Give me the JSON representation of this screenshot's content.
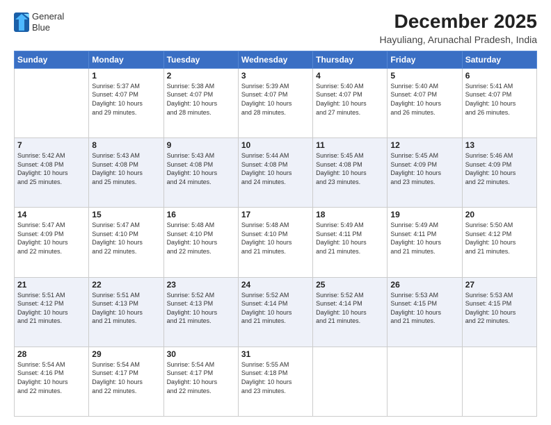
{
  "header": {
    "logo_line1": "General",
    "logo_line2": "Blue",
    "title": "December 2025",
    "subtitle": "Hayuliang, Arunachal Pradesh, India"
  },
  "days_of_week": [
    "Sunday",
    "Monday",
    "Tuesday",
    "Wednesday",
    "Thursday",
    "Friday",
    "Saturday"
  ],
  "weeks": [
    [
      {
        "day": "",
        "info": ""
      },
      {
        "day": "1",
        "info": "Sunrise: 5:37 AM\nSunset: 4:07 PM\nDaylight: 10 hours\nand 29 minutes."
      },
      {
        "day": "2",
        "info": "Sunrise: 5:38 AM\nSunset: 4:07 PM\nDaylight: 10 hours\nand 28 minutes."
      },
      {
        "day": "3",
        "info": "Sunrise: 5:39 AM\nSunset: 4:07 PM\nDaylight: 10 hours\nand 28 minutes."
      },
      {
        "day": "4",
        "info": "Sunrise: 5:40 AM\nSunset: 4:07 PM\nDaylight: 10 hours\nand 27 minutes."
      },
      {
        "day": "5",
        "info": "Sunrise: 5:40 AM\nSunset: 4:07 PM\nDaylight: 10 hours\nand 26 minutes."
      },
      {
        "day": "6",
        "info": "Sunrise: 5:41 AM\nSunset: 4:07 PM\nDaylight: 10 hours\nand 26 minutes."
      }
    ],
    [
      {
        "day": "7",
        "info": "Sunrise: 5:42 AM\nSunset: 4:08 PM\nDaylight: 10 hours\nand 25 minutes."
      },
      {
        "day": "8",
        "info": "Sunrise: 5:43 AM\nSunset: 4:08 PM\nDaylight: 10 hours\nand 25 minutes."
      },
      {
        "day": "9",
        "info": "Sunrise: 5:43 AM\nSunset: 4:08 PM\nDaylight: 10 hours\nand 24 minutes."
      },
      {
        "day": "10",
        "info": "Sunrise: 5:44 AM\nSunset: 4:08 PM\nDaylight: 10 hours\nand 24 minutes."
      },
      {
        "day": "11",
        "info": "Sunrise: 5:45 AM\nSunset: 4:08 PM\nDaylight: 10 hours\nand 23 minutes."
      },
      {
        "day": "12",
        "info": "Sunrise: 5:45 AM\nSunset: 4:09 PM\nDaylight: 10 hours\nand 23 minutes."
      },
      {
        "day": "13",
        "info": "Sunrise: 5:46 AM\nSunset: 4:09 PM\nDaylight: 10 hours\nand 22 minutes."
      }
    ],
    [
      {
        "day": "14",
        "info": "Sunrise: 5:47 AM\nSunset: 4:09 PM\nDaylight: 10 hours\nand 22 minutes."
      },
      {
        "day": "15",
        "info": "Sunrise: 5:47 AM\nSunset: 4:10 PM\nDaylight: 10 hours\nand 22 minutes."
      },
      {
        "day": "16",
        "info": "Sunrise: 5:48 AM\nSunset: 4:10 PM\nDaylight: 10 hours\nand 22 minutes."
      },
      {
        "day": "17",
        "info": "Sunrise: 5:48 AM\nSunset: 4:10 PM\nDaylight: 10 hours\nand 21 minutes."
      },
      {
        "day": "18",
        "info": "Sunrise: 5:49 AM\nSunset: 4:11 PM\nDaylight: 10 hours\nand 21 minutes."
      },
      {
        "day": "19",
        "info": "Sunrise: 5:49 AM\nSunset: 4:11 PM\nDaylight: 10 hours\nand 21 minutes."
      },
      {
        "day": "20",
        "info": "Sunrise: 5:50 AM\nSunset: 4:12 PM\nDaylight: 10 hours\nand 21 minutes."
      }
    ],
    [
      {
        "day": "21",
        "info": "Sunrise: 5:51 AM\nSunset: 4:12 PM\nDaylight: 10 hours\nand 21 minutes."
      },
      {
        "day": "22",
        "info": "Sunrise: 5:51 AM\nSunset: 4:13 PM\nDaylight: 10 hours\nand 21 minutes."
      },
      {
        "day": "23",
        "info": "Sunrise: 5:52 AM\nSunset: 4:13 PM\nDaylight: 10 hours\nand 21 minutes."
      },
      {
        "day": "24",
        "info": "Sunrise: 5:52 AM\nSunset: 4:14 PM\nDaylight: 10 hours\nand 21 minutes."
      },
      {
        "day": "25",
        "info": "Sunrise: 5:52 AM\nSunset: 4:14 PM\nDaylight: 10 hours\nand 21 minutes."
      },
      {
        "day": "26",
        "info": "Sunrise: 5:53 AM\nSunset: 4:15 PM\nDaylight: 10 hours\nand 21 minutes."
      },
      {
        "day": "27",
        "info": "Sunrise: 5:53 AM\nSunset: 4:15 PM\nDaylight: 10 hours\nand 22 minutes."
      }
    ],
    [
      {
        "day": "28",
        "info": "Sunrise: 5:54 AM\nSunset: 4:16 PM\nDaylight: 10 hours\nand 22 minutes."
      },
      {
        "day": "29",
        "info": "Sunrise: 5:54 AM\nSunset: 4:17 PM\nDaylight: 10 hours\nand 22 minutes."
      },
      {
        "day": "30",
        "info": "Sunrise: 5:54 AM\nSunset: 4:17 PM\nDaylight: 10 hours\nand 22 minutes."
      },
      {
        "day": "31",
        "info": "Sunrise: 5:55 AM\nSunset: 4:18 PM\nDaylight: 10 hours\nand 23 minutes."
      },
      {
        "day": "",
        "info": ""
      },
      {
        "day": "",
        "info": ""
      },
      {
        "day": "",
        "info": ""
      }
    ]
  ]
}
